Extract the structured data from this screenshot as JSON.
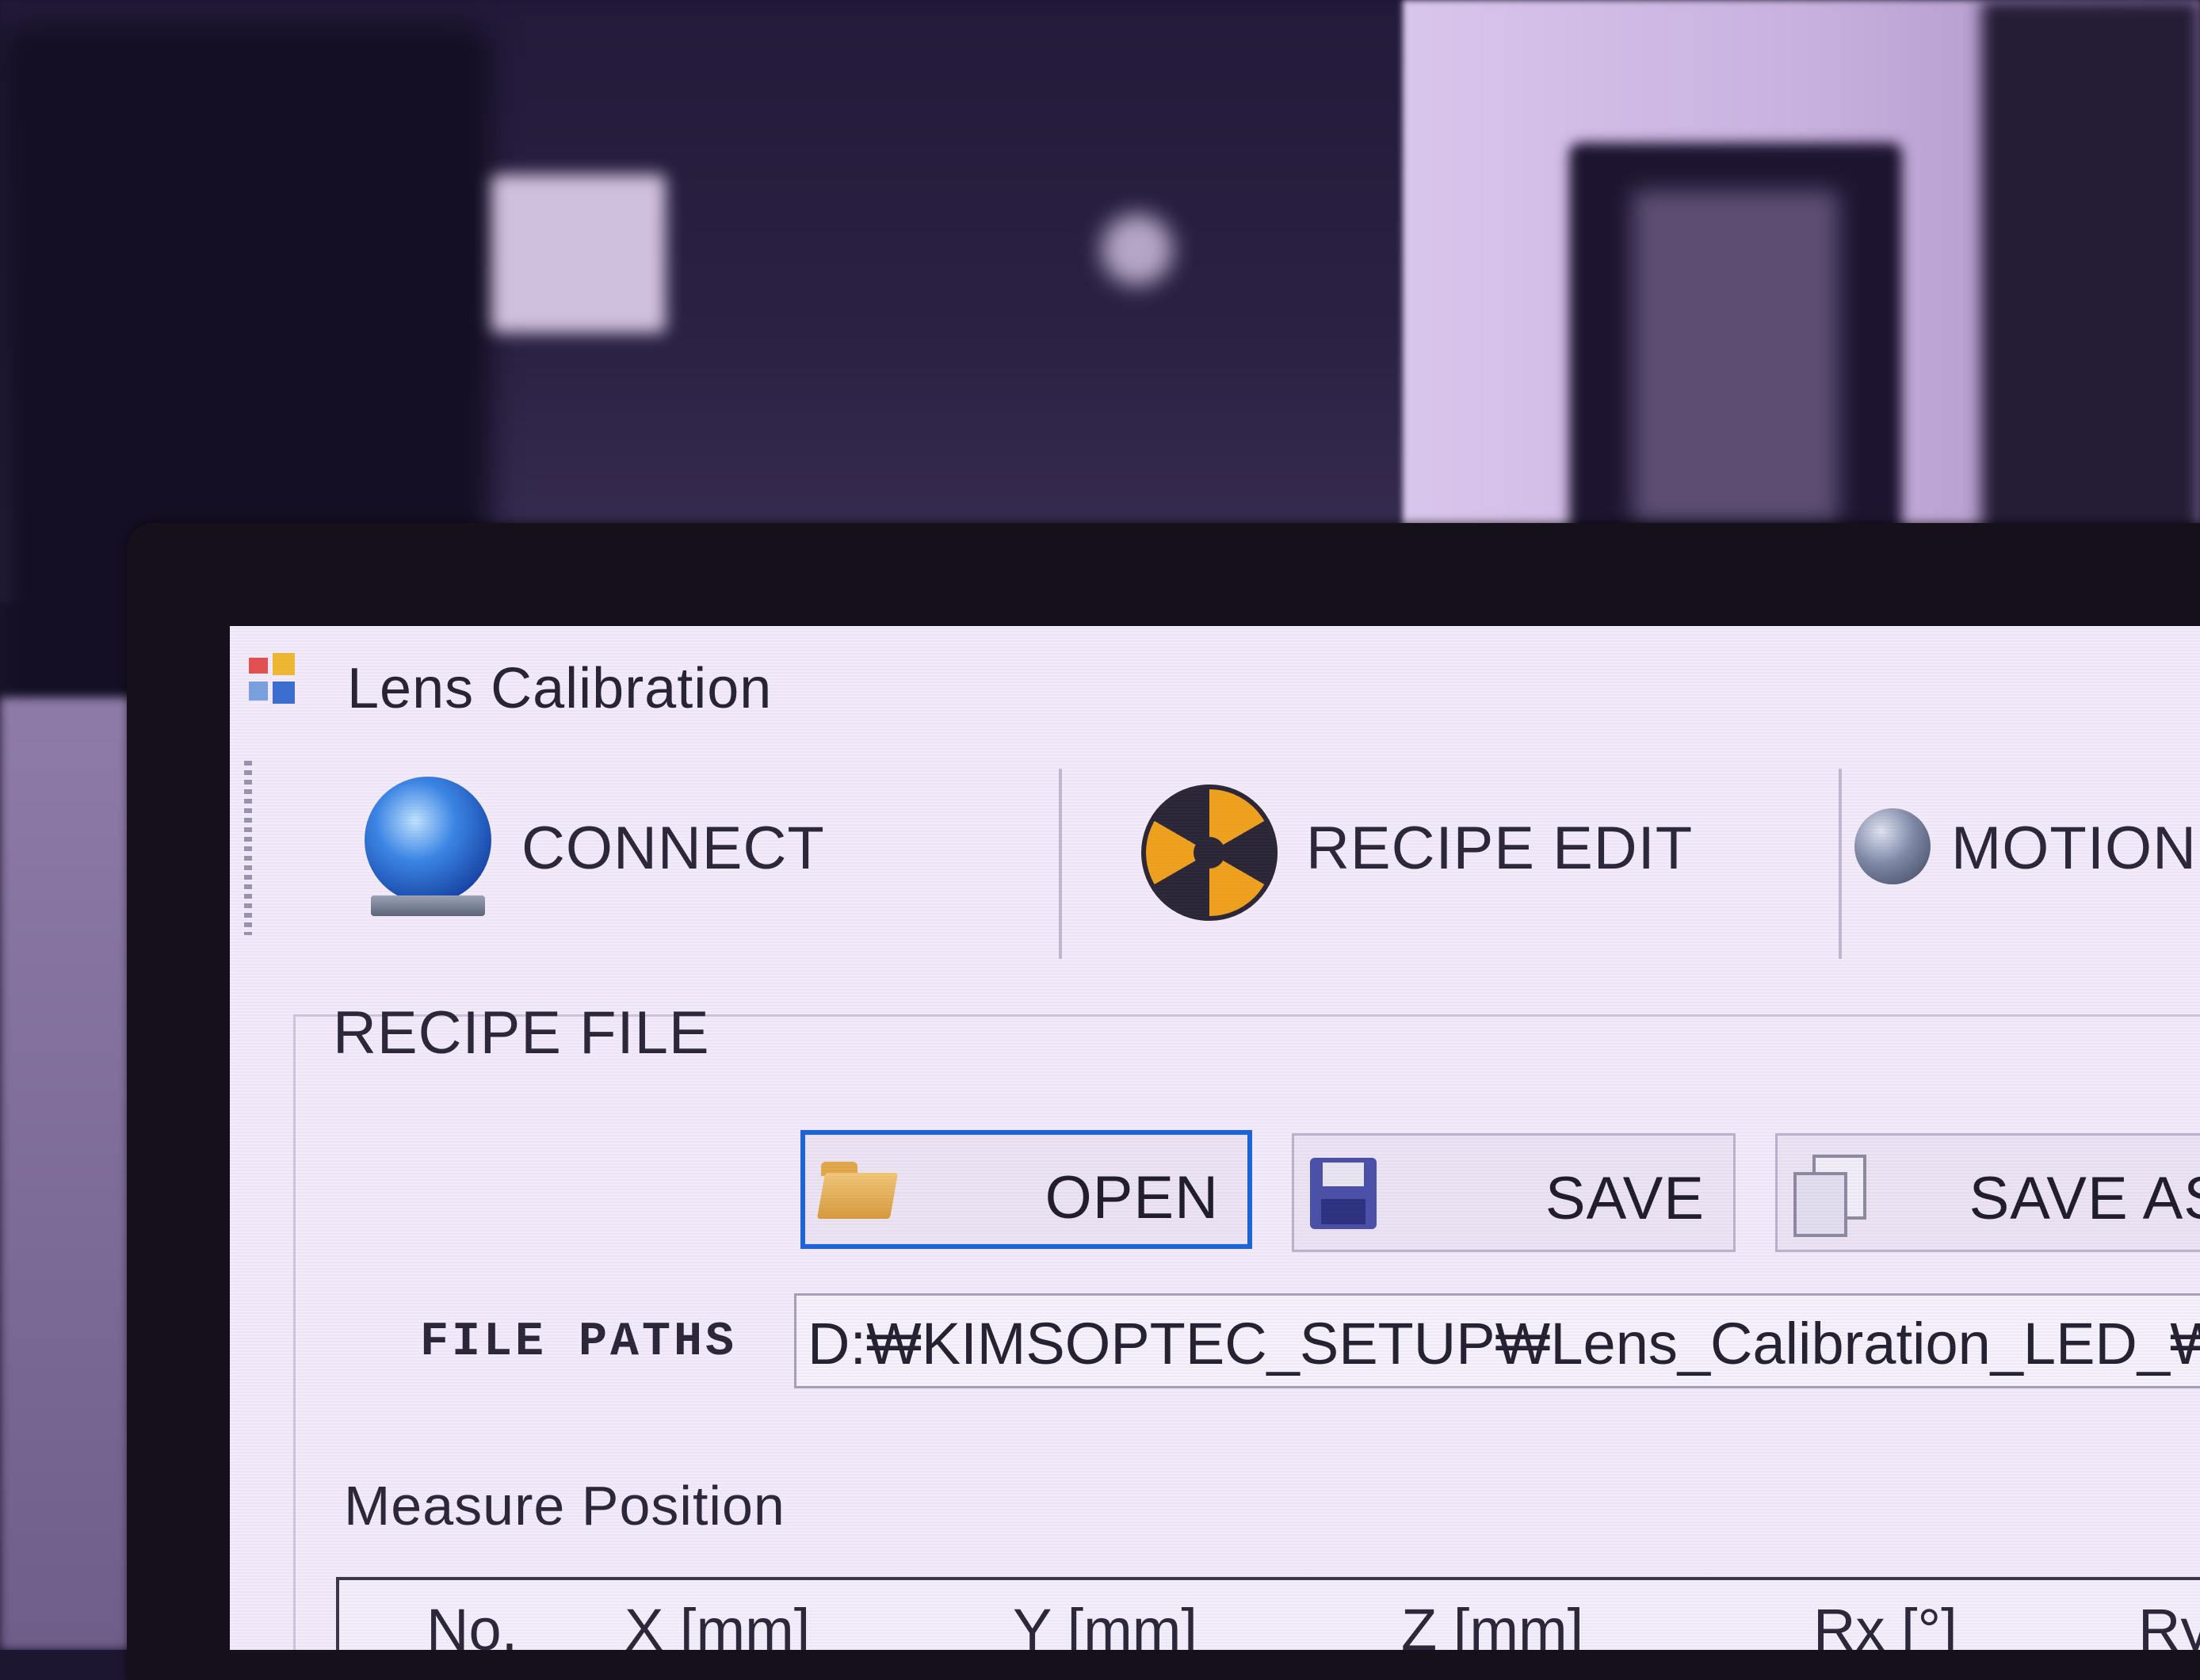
{
  "window": {
    "title": "Lens Calibration",
    "icon": "app-grid-icon"
  },
  "toolbar": {
    "items": [
      {
        "label": "CONNECT",
        "icon": "globe-icon"
      },
      {
        "label": "RECIPE EDIT",
        "icon": "radiation-icon"
      },
      {
        "label": "MOTION",
        "icon": "sphere-icon"
      }
    ]
  },
  "recipe_file": {
    "group_label": "RECIPE FILE",
    "open_label": "OPEN",
    "save_label": "SAVE",
    "save_as_label": "SAVE AS",
    "file_paths_label": "FILE PATHS",
    "file_path_value": "D:₩KIMSOPTEC_SETUP₩Lens_Calibration_LED_₩"
  },
  "measure_position": {
    "group_label": "Measure Position",
    "columns": [
      "No.",
      "X [mm]",
      "Y [mm]",
      "Z [mm]",
      "Rx [°]",
      "Ry"
    ]
  },
  "colors": {
    "focus_border": "#1b63d8",
    "window_bg": "#f3ebfa",
    "text": "#2a2638"
  }
}
